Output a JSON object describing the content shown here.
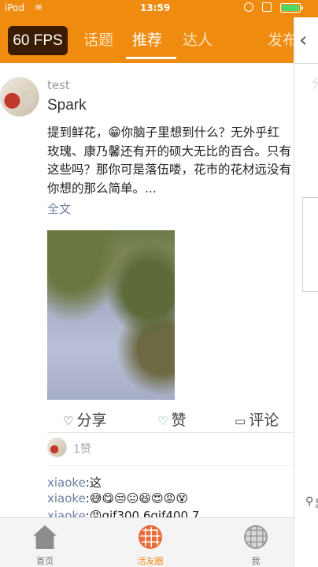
{
  "status_bar": {
    "carrier": "iPod",
    "wifi_icon": "wifi-icon",
    "time": "13:59",
    "battery_color": "#4cd964"
  },
  "nav": {
    "fps": "60 FPS",
    "tabs": [
      {
        "label": "话题",
        "active": false
      },
      {
        "label": "推荐",
        "active": true
      },
      {
        "label": "达人",
        "active": false
      },
      {
        "label": "发布",
        "active": false
      }
    ],
    "accent_color": "#ef8b0f"
  },
  "post": {
    "username": "test",
    "subtitle": "Spark",
    "body": "提到鲜花，😁你脑子里想到什么？无外乎红玫瑰、康乃馨还有开的硕大无比的百合。只有这些吗？那你可是落伍喽，花市的花材远没有你想的那么简单。...",
    "fulltext_label": "全文",
    "actions": {
      "share": "分享",
      "like": "赞",
      "comment": "评论"
    },
    "like_count": "1赞",
    "comments": [
      {
        "user": "xiaoke",
        "text": "这"
      },
      {
        "user": "xiaoke",
        "text": "😅😋😒😐😆😍😡😵"
      },
      {
        "user": "xiaoke",
        "text": "😡gif300 6gif400 7"
      }
    ]
  },
  "right_pane": {
    "back_icon": "chevron-left-icon",
    "ghost_char": "分",
    "location_label": "显"
  },
  "tab_bar": {
    "items": [
      {
        "label": "首页",
        "icon": "home-icon",
        "active": false
      },
      {
        "label": "活友圈",
        "icon": "globe-icon",
        "active": true
      },
      {
        "label": "我",
        "icon": "globe-icon",
        "active": false
      }
    ]
  }
}
